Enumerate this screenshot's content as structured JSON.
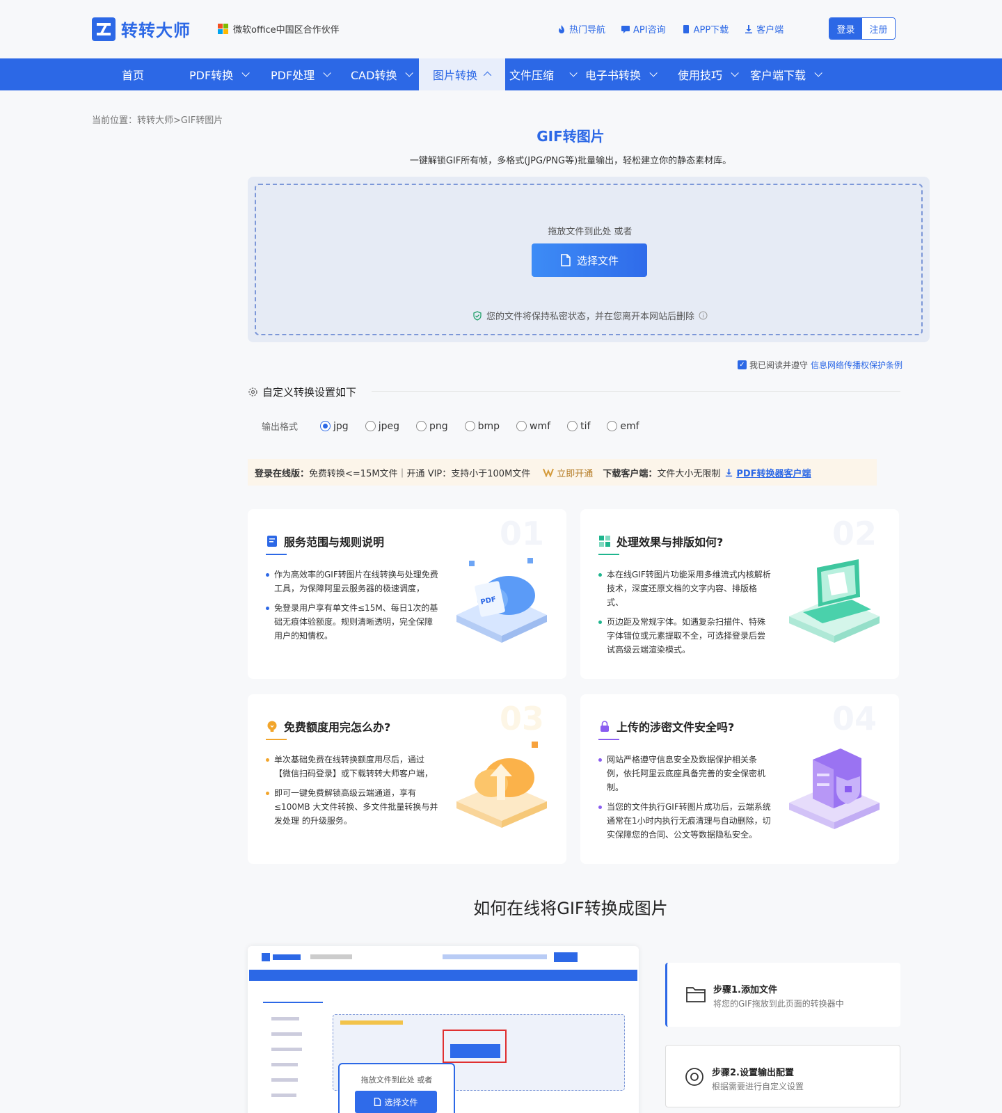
{
  "header": {
    "logo_text": "转转大师",
    "partner_text": "微软office中国区合作伙伴",
    "links": [
      "热门导航",
      "API咨询",
      "APP下载",
      "客户端"
    ],
    "login_label": "登录",
    "register_label": "注册",
    "accent_color": "#2c68e6"
  },
  "nav": {
    "items": [
      "首页",
      "PDF转换",
      "PDF处理",
      "CAD转换",
      "图片转换",
      "文件压缩",
      "电子书转换",
      "使用技巧",
      "客户端下载"
    ],
    "active": "图片转换"
  },
  "breadcrumb": "当前位置：转转大师>GIF转图片",
  "page": {
    "title": "GIF转图片",
    "subtitle": "一键解锁GIF所有帧，多格式(JPG/PNG等)批量输出，轻松建立你的静态素材库。"
  },
  "upload": {
    "drop_text": "拖放文件到此处 或者",
    "button_label": "选择文件",
    "privacy_text": "您的文件将保持私密状态，并在您离开本网站后删除"
  },
  "agreement": {
    "prefix": "我已阅读并遵守",
    "link": "信息网络传播权保护条例",
    "checked": true
  },
  "settings": {
    "heading": "自定义转换设置如下",
    "format_label": "输出格式",
    "formats": [
      "jpg",
      "jpeg",
      "png",
      "bmp",
      "wmf",
      "tif",
      "emf"
    ],
    "selected": "jpg"
  },
  "vip_bar": {
    "online_label": "登录在线版：",
    "online_text": "免费转换<=15M文件｜开通 VIP：支持小于100M文件",
    "open_label": "立即开通",
    "client_label": "下载客户端：",
    "client_text": "文件大小无限制",
    "client_link": "PDF转换器客户端"
  },
  "cards": [
    {
      "num": "01",
      "title": "服务范围与规则说明",
      "color": "#2c68e6",
      "items": [
        "作为高效率的GIF转图片在线转换与处理免费工具，为保障阿里云服务器的极速调度，",
        "免登录用户享有单文件≤15M、每日1次的基础无痕体验额度。规则清晰透明，完全保障用户的知情权。"
      ]
    },
    {
      "num": "02",
      "title": "处理效果与排版如何?",
      "color": "#1fb58e",
      "items": [
        "本在线GIF转图片功能采用多维流式内核解析技术，深度还原文档的文字内容、排版格式、",
        "页边距及常规字体。如遇复杂扫描件、特殊字体错位或元素提取不全，可选择登录后尝试高级云端渲染模式。"
      ]
    },
    {
      "num": "03",
      "title": "免费额度用完怎么办?",
      "color": "#f2a52b",
      "items": [
        "单次基础免费在线转换额度用尽后，通过【微信扫码登录】或下载转转大师客户端，",
        "即可一键免费解锁高级云端通道，享有≤100MB 大文件转换、多文件批量转换与并发处理 的升级服务。"
      ]
    },
    {
      "num": "04",
      "title": "上传的涉密文件安全吗?",
      "color": "#8a5cf0",
      "items": [
        "网站严格遵守信息安全及数据保护相关条例，依托阿里云底座具备完善的安全保密机制。",
        "当您的文件执行GIF转图片成功后，云端系统通常在1小时内执行无痕清理与自动删除，切实保障您的合同、公文等数据隐私安全。"
      ]
    }
  ],
  "how_to": {
    "title": "如何在线将GIF转换成图片",
    "popup_text": "拖放文件到此处 或者",
    "popup_button": "选择文件",
    "steps": [
      {
        "title": "步骤1.添加文件",
        "desc": "将您的GIF拖放到此页面的转换器中"
      },
      {
        "title": "步骤2.设置输出配置",
        "desc": "根据需要进行自定义设置"
      }
    ]
  }
}
